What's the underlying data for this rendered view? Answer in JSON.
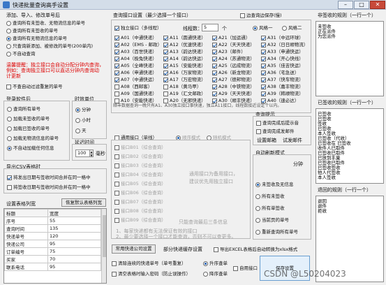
{
  "window": {
    "title": "快递批量查询高手设置"
  },
  "left": {
    "opts_title": "添加、导入、修改单号后",
    "opts": [
      "查询所有未签收、无物流信息的单号",
      "查询所有未签收的单号",
      "查询所有无物流信息的单号",
      "只查询新添加、被修改的单号(200单内)",
      "不自动查询"
    ],
    "opts_selected": 2,
    "note": [
      "温馨提醒：独立接口会自动分配分钟内查询，",
      "例如：查询独立接口可以直达分钟内查询动",
      "计更新"
    ],
    "no_auto_dup": "不查自动过滤重复的单号",
    "login_title": "登录软件后",
    "login_opts": [
      "查询所有单号",
      "加载未签收的单号",
      "加载已签收的单号",
      "加载无物流信息的单号",
      "不自动加载任何信息"
    ],
    "login_selected": 4,
    "time_title": "时效单位",
    "time_opts": [
      "分钟",
      "小时",
      "天"
    ],
    "time_selected": 0,
    "delay_title": "延迟时间",
    "delay_value": "100",
    "delay_unit": "毫秒",
    "csv_title": "导出CSV表格时",
    "csv_opts": [
      "将发出日期与签收时间合并在同一格中",
      "将签收日期与签收时间合并在同一格中"
    ],
    "csv_checked": [
      true,
      false
    ],
    "col_title": "设置表格列宽",
    "reset_btn": "恢复默认表格列宽",
    "col_headers": [
      "标题",
      "宽度"
    ],
    "col_rows": [
      [
        "序号",
        "55"
      ],
      [
        "查询时间",
        "135"
      ],
      [
        "快递单号",
        "120"
      ],
      [
        "快递公司",
        "95"
      ],
      [
        "订单编号",
        "75"
      ],
      [
        "买家",
        "70"
      ],
      [
        "联系电话",
        "95"
      ]
    ]
  },
  "mid": {
    "api_title": "查询接口设置（最少选择一个接口）",
    "edge_label": "边查询边保存(慢)",
    "independent": "独立接口（多线程）",
    "threads_label": "线程数：",
    "threads_value": "5",
    "threads_unit": "个",
    "style1": "风格一",
    "style2": "风格二",
    "carriers_c1": [
      "A01（中通快递）",
      "A02（EMS - 邮政）",
      "A03（百世快递）",
      "A04（极兔快递）",
      "A05（全峰快递）",
      "A06（申通快递）",
      "A07（中通快运）",
      "A08（西邮客）",
      "A09（国通快递）",
      "A10（安能快递）"
    ],
    "carriers_c2": [
      "A11（圆通快递）",
      "A12（优速快递）",
      "A13（韵达快递）",
      "A14（韵达快运）",
      "A15（安能快递）",
      "A16（万家物流）",
      "A17（万宏物流）",
      "A18（黄马甲）",
      "A19（汇文邮政）",
      "A20（无邪快递）"
    ],
    "carriers_c3": [
      "A21（加运通）",
      "A22（天天快递）",
      "A23（邮件）",
      "A24（苏通物流）",
      "A25（远成物流）",
      "A26（新龙物流）",
      "A27（德邦物流）",
      "A28（中铁物流）",
      "A29（天天快递）",
      "A30（顺丰快递）"
    ],
    "carriers_c4": [
      "A31（中远环球）",
      "A32（日日顺物流）",
      "A33（申通快运）",
      "A34（开心快线）",
      "A35（佳吉快运）",
      "A36（宅急送）",
      "A37（快车物流）",
      "A38（嘉丰物流）",
      "A39（韩顺物流）",
      "A40（速必达）"
    ],
    "checked_c1": [
      true,
      true,
      true,
      true,
      true,
      true,
      true,
      false,
      false,
      false
    ],
    "checked_c2": [
      true,
      true,
      true,
      true,
      true,
      true,
      true,
      false,
      false,
      false
    ],
    "checked_c3": [
      true,
      true,
      true,
      true,
      true,
      true,
      true,
      true,
      true,
      true
    ],
    "checked_c4": [
      true,
      true,
      true,
      true,
      true,
      true,
      true,
      true,
      true,
      true
    ],
    "api_note": "顺丰数据查询一晚只有A1、A30独立接口事快速，独立A11接口，线程数接近设定个以内。",
    "generic": "通用接口（单线）",
    "seq_mode": "顺序模式",
    "rand_mode": "随机模式",
    "generic_items": [
      "接口B01（综合查询）",
      "接口B02（综合查询）",
      "接口B03（综合查询）",
      "接口B04（综合查询）",
      "接口B05（综合查询）",
      "接口B06（综合查询）",
      "接口B07（综合查询）",
      "接口B08（综合查询）",
      "接口B09（综合查询）"
    ],
    "generic_hint": [
      "通用接口为备用接口，",
      "建议优先用独立接口"
    ],
    "generic_note1": "只能查询最后三条信息",
    "footer_note1": "1、每家快递都有无法保证有效的接口",
    "footer_note2": "2、最少要选择一个接口才能查询，否则不可以查更多。",
    "btn_common": "常用快递公司设置",
    "btn_partial": "部分快递缓存设置",
    "export_label": "导出EXCEL表格后自动转换为xlsx格式",
    "clear_label": "清除连续的快递单号（单号重复）",
    "clear_all": "清空表格时输入密码（防止误操作）",
    "asc": "升序查单",
    "desc": "降序查单",
    "auto_api": "自用接口"
  },
  "notify": {
    "title": "查询提示",
    "items": [
      "查询完成后提示音",
      "查询完成发邮件"
    ],
    "mail_btn": "设置邮箱",
    "test_btn": "试发邮件"
  },
  "refresh": {
    "title": "自动刷新模式",
    "opts": [
      "未签收及无信息",
      "所有未签收",
      "所有单签收",
      "当前页的单号",
      "重新查询所有单号"
    ],
    "selected": 0,
    "min_label": "分钟",
    "save_btn": "保存设置"
  },
  "right": {
    "box1_title": "非签收的规则（一行一个）",
    "box1_lines": [
      "未签收",
      "正在派件",
      "为您派件"
    ],
    "box2_title": "已签收的规则（一行一个）",
    "box2_lines": [
      "已签收",
      "已签收",
      "签收",
      "已签收",
      "本人签收",
      "已签收（代收）",
      "已签收在 已签收",
      "收件人已取件",
      "已签收已取件",
      "已放到丰巢",
      "已签收已取件",
      "已签收签收",
      "他人代签收",
      "本人签收"
    ],
    "box3_title": "退回的规则（一行一个）",
    "box3_lines": [
      "退回",
      "退件",
      "拒收"
    ]
  },
  "watermark": "CSDN @L50204023"
}
